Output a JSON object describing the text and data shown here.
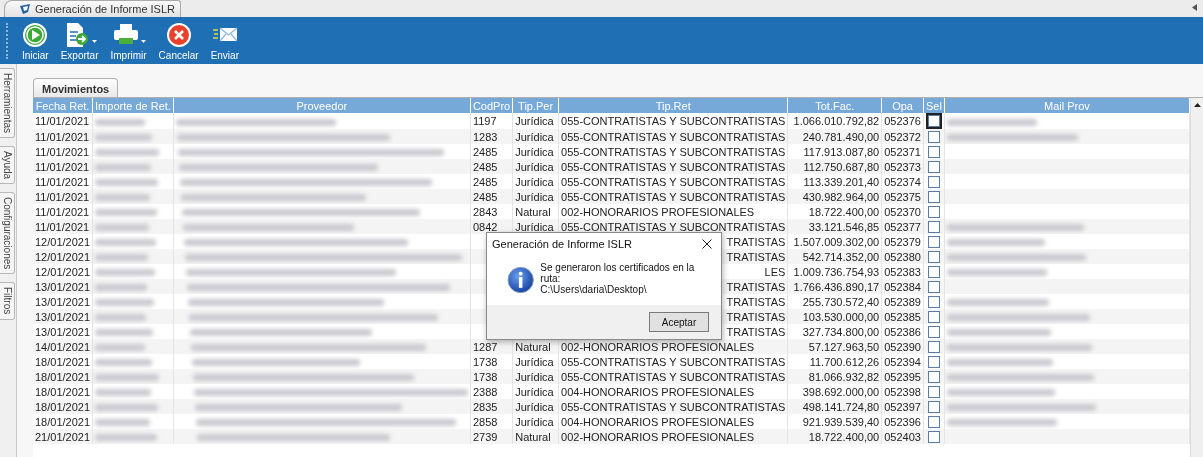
{
  "document_tab": {
    "title": "Generación de Informe ISLR"
  },
  "toolbar": [
    {
      "kind": "play",
      "label": "Iniciar",
      "dropdown": false
    },
    {
      "kind": "export",
      "label": "Exportar",
      "dropdown": true
    },
    {
      "kind": "print",
      "label": "Imprimir",
      "dropdown": true
    },
    {
      "kind": "cancel",
      "label": "Cancelar",
      "dropdown": false
    },
    {
      "kind": "mail",
      "label": "Enviar",
      "dropdown": false
    }
  ],
  "side_tabs": [
    "Herramientas",
    "Ayuda",
    "Configuraciones",
    "Filtros"
  ],
  "grid_tab": {
    "title": "Movimientos"
  },
  "table": {
    "columns": [
      "Fecha Ret.",
      "Importe de Ret.",
      "Proveedor",
      "CodPro",
      "Tip.Per",
      "Tip.Ret",
      "Tot.Fac.",
      "Opa",
      "Sel",
      "Mail Prov"
    ],
    "rows": [
      {
        "fecha": "11/01/2021",
        "codpro": "1197",
        "tip_per": "Jurídica",
        "tip_ret": "055-CONTRATISTAS Y SUBCONTRATISTAS",
        "tot_fac": "1.066.010.792,82",
        "opa": "052376",
        "checked": false,
        "focused": true,
        "mail_redacted": true
      },
      {
        "fecha": "11/01/2021",
        "codpro": "1283",
        "tip_per": "Jurídica",
        "tip_ret": "055-CONTRATISTAS Y SUBCONTRATISTAS",
        "tot_fac": "240.781.490,00",
        "opa": "052372",
        "checked": false,
        "focused": false,
        "mail_redacted": true
      },
      {
        "fecha": "11/01/2021",
        "codpro": "2485",
        "tip_per": "Jurídica",
        "tip_ret": "055-CONTRATISTAS Y SUBCONTRATISTAS",
        "tot_fac": "117.913.087,80",
        "opa": "052371",
        "checked": false,
        "focused": false,
        "mail_redacted": false
      },
      {
        "fecha": "11/01/2021",
        "codpro": "2485",
        "tip_per": "Jurídica",
        "tip_ret": "055-CONTRATISTAS Y SUBCONTRATISTAS",
        "tot_fac": "112.750.687,80",
        "opa": "052373",
        "checked": false,
        "focused": false,
        "mail_redacted": false
      },
      {
        "fecha": "11/01/2021",
        "codpro": "2485",
        "tip_per": "Jurídica",
        "tip_ret": "055-CONTRATISTAS Y SUBCONTRATISTAS",
        "tot_fac": "113.339.201,40",
        "opa": "052374",
        "checked": false,
        "focused": false,
        "mail_redacted": false
      },
      {
        "fecha": "11/01/2021",
        "codpro": "2485",
        "tip_per": "Jurídica",
        "tip_ret": "055-CONTRATISTAS Y SUBCONTRATISTAS",
        "tot_fac": "430.982.964,00",
        "opa": "052375",
        "checked": false,
        "focused": false,
        "mail_redacted": false
      },
      {
        "fecha": "11/01/2021",
        "codpro": "2843",
        "tip_per": "Natural",
        "tip_ret": "002-HONORARIOS PROFESIONALES",
        "tot_fac": "18.722.400,00",
        "opa": "052370",
        "checked": false,
        "focused": false,
        "mail_redacted": false
      },
      {
        "fecha": "11/01/2021",
        "codpro": "0842",
        "tip_per": "Jurídica",
        "tip_ret": "055-CONTRATISTAS Y SUBCONTRATISTAS",
        "tot_fac": "33.121.546,85",
        "opa": "052377",
        "checked": false,
        "focused": false,
        "mail_redacted": true
      },
      {
        "fecha": "12/01/2021",
        "tip_ret": "TRATISTAS",
        "tot_fac": "1.507.009.302,00",
        "opa": "052379",
        "checked": false,
        "focused": false,
        "mail_redacted": true
      },
      {
        "fecha": "12/01/2021",
        "tip_ret": "TRATISTAS",
        "tot_fac": "542.714.352,00",
        "opa": "052380",
        "checked": false,
        "focused": false,
        "mail_redacted": true
      },
      {
        "fecha": "12/01/2021",
        "tip_ret": "LES",
        "tot_fac": "1.009.736.754,93",
        "opa": "052383",
        "checked": false,
        "focused": false,
        "mail_redacted": true
      },
      {
        "fecha": "13/01/2021",
        "tip_ret": "TRATISTAS",
        "tot_fac": "1.766.436.890,17",
        "opa": "052384",
        "checked": false,
        "focused": false,
        "mail_redacted": false
      },
      {
        "fecha": "13/01/2021",
        "tip_ret": "TRATISTAS",
        "tot_fac": "255.730.572,40",
        "opa": "052389",
        "checked": false,
        "focused": false,
        "mail_redacted": true
      },
      {
        "fecha": "13/01/2021",
        "tip_ret": "TRATISTAS",
        "tot_fac": "103.530.000,00",
        "opa": "052385",
        "checked": false,
        "focused": false,
        "mail_redacted": true
      },
      {
        "fecha": "13/01/2021",
        "tip_ret": "TRATISTAS",
        "tot_fac": "327.734.800,00",
        "opa": "052386",
        "checked": false,
        "focused": false,
        "mail_redacted": true
      },
      {
        "fecha": "14/01/2021",
        "codpro": "1287",
        "tip_per": "Natural",
        "tip_ret": "002-HONORARIOS PROFESIONALES",
        "tot_fac": "57.127.963,50",
        "opa": "052390",
        "checked": false,
        "focused": false,
        "mail_redacted": true
      },
      {
        "fecha": "18/01/2021",
        "codpro": "1738",
        "tip_per": "Jurídica",
        "tip_ret": "055-CONTRATISTAS Y SUBCONTRATISTAS",
        "tot_fac": "11.700.612,26",
        "opa": "052394",
        "checked": false,
        "focused": false,
        "mail_redacted": true
      },
      {
        "fecha": "18/01/2021",
        "codpro": "1738",
        "tip_per": "Jurídica",
        "tip_ret": "055-CONTRATISTAS Y SUBCONTRATISTAS",
        "tot_fac": "81.066.932,82",
        "opa": "052395",
        "checked": false,
        "focused": false,
        "mail_redacted": true
      },
      {
        "fecha": "18/01/2021",
        "codpro": "2388",
        "tip_per": "Jurídica",
        "tip_ret": "004-HONORARIOS PROFESIONALES",
        "tot_fac": "398.692.000,00",
        "opa": "052398",
        "checked": false,
        "focused": false,
        "mail_redacted": true
      },
      {
        "fecha": "18/01/2021",
        "codpro": "2835",
        "tip_per": "Jurídica",
        "tip_ret": "055-CONTRATISTAS Y SUBCONTRATISTAS",
        "tot_fac": "498.141.724,80",
        "opa": "052397",
        "checked": false,
        "focused": false,
        "mail_redacted": true
      },
      {
        "fecha": "18/01/2021",
        "codpro": "2858",
        "tip_per": "Jurídica",
        "tip_ret": "004-HONORARIOS PROFESIONALES",
        "tot_fac": "921.939.539,40",
        "opa": "052396",
        "checked": false,
        "focused": false,
        "mail_redacted": true
      },
      {
        "fecha": "21/01/2021",
        "codpro": "2739",
        "tip_per": "Natural",
        "tip_ret": "002-HONORARIOS PROFESIONALES",
        "tot_fac": "18.722.400,00",
        "opa": "052403",
        "checked": false,
        "focused": false,
        "mail_redacted": false
      }
    ]
  },
  "dialog": {
    "title": "Generación de Informe ISLR",
    "message": "Se generaron los certificados en la ruta:",
    "path": "C:\\Users\\daria\\Desktop\\",
    "button": "Aceptar"
  }
}
